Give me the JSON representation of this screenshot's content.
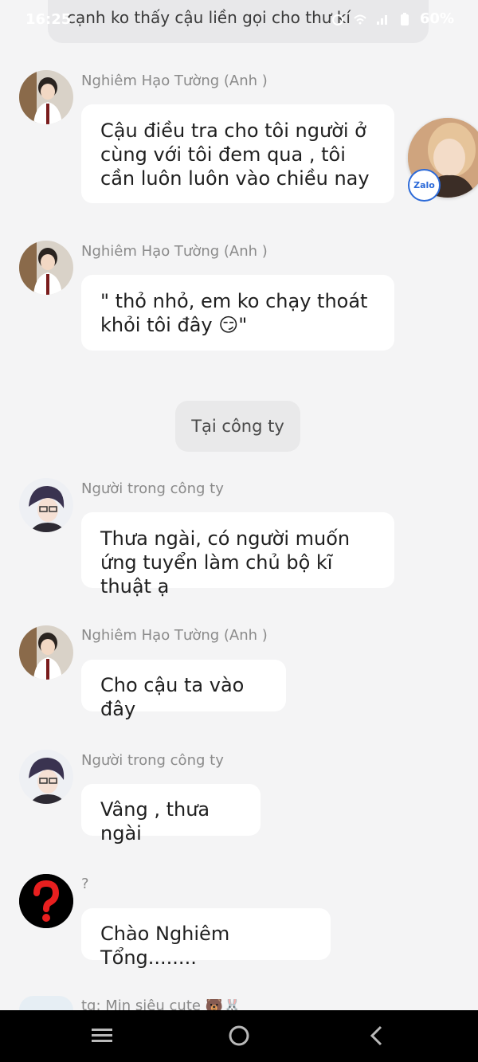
{
  "status_bar": {
    "time": "16:25",
    "battery": "60%"
  },
  "top_partial": {
    "text": "cạnh ko thấy cậu liền gọi cho thư kí"
  },
  "floating_chat": {
    "badge": "Zalo"
  },
  "messages": [
    {
      "sender": "Nghiêm Hạo Tường (Anh )",
      "text": "Cậu điều tra cho tôi người ở cùng với tôi đem qua , tôi cần luôn luôn vào chiều nay"
    },
    {
      "sender": "Nghiêm Hạo Tường (Anh )",
      "text": "\" thỏ nhỏ, em ko chạy thoát khỏi tôi đây 😏\""
    },
    {
      "sender": "Người trong công ty",
      "text": "Thưa ngài, có người muốn ứng tuyển làm chủ bộ kĩ thuật ạ"
    },
    {
      "sender": "Nghiêm Hạo Tường (Anh )",
      "text": "Cho cậu ta vào đây"
    },
    {
      "sender": "Người trong công ty",
      "text": "Vâng , thưa ngài"
    },
    {
      "sender": "?",
      "text": "Chào Nghiêm Tổng........"
    }
  ],
  "center_label": "Tại công ty",
  "partial_sender": "tg: Min siêu cute 🐻🐰",
  "colors": {
    "background": "#f4f4f5",
    "bubble": "#ffffff",
    "sender": "#8a8a8a",
    "navbar": "#000000"
  },
  "icons": [
    "menu-icon",
    "home-circle-icon",
    "back-chevron-icon",
    "question-mark-icon"
  ]
}
